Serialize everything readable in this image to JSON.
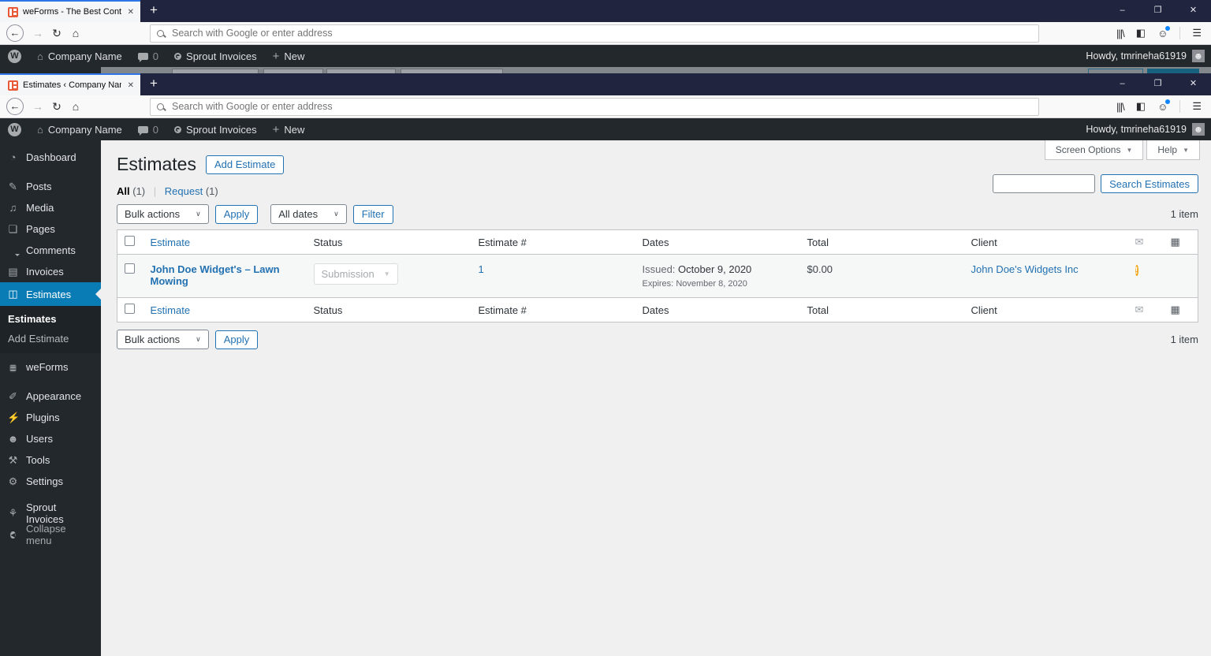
{
  "colors": {
    "accent_blue": "#2271b1",
    "active_menu_blue": "#0a7cb5",
    "warning_orange": "#f0a009",
    "active_tab_line": "#2e75e8"
  },
  "browser": {
    "window1": {
      "tab_title": "weForms - The Best Contact Fo"
    },
    "window2": {
      "tab_title": "Estimates ‹ Company Name —"
    },
    "tab_close": "✕",
    "new_tab": "+",
    "url_placeholder": "Search with Google or enter address",
    "toolbar_icons": {
      "back": "←",
      "forward": "→",
      "refresh": "↻",
      "home": "⌂",
      "library": "|||\\",
      "sidebar_toggle": "◧",
      "account": "☺",
      "menu": "☰"
    },
    "controls": {
      "minimize": "–",
      "restore": "❐",
      "close": "✕"
    }
  },
  "admin_bar": {
    "wp_logo": "W",
    "home_icon": "⌂",
    "site_name": "Company Name",
    "comments_count": "0",
    "sprout_label": "Sprout Invoices",
    "new_icon": "+",
    "new_label": "New",
    "howdy": "Howdy, tmrineha61919",
    "avatar_glyph": "☻"
  },
  "sidebar": {
    "items": [
      {
        "icon": "◔",
        "label": "Dashboard"
      },
      {
        "icon": "✎",
        "label": "Posts"
      },
      {
        "icon": "♫",
        "label": "Media"
      },
      {
        "icon": "❏",
        "label": "Pages"
      },
      {
        "icon": "",
        "label": "Comments"
      },
      {
        "icon": "▤",
        "label": "Invoices"
      },
      {
        "icon": "◫",
        "label": "Estimates"
      },
      {
        "icon": "☰",
        "label": "weForms"
      },
      {
        "icon": "✐",
        "label": "Appearance"
      },
      {
        "icon": "⚡",
        "label": "Plugins"
      },
      {
        "icon": "☻",
        "label": "Users"
      },
      {
        "icon": "⚒",
        "label": "Tools"
      },
      {
        "icon": "⚙",
        "label": "Settings"
      },
      {
        "icon": "⚘",
        "label": "Sprout Invoices"
      },
      {
        "icon": "◀",
        "label": "Collapse menu"
      }
    ],
    "submenu": [
      {
        "label": "Estimates"
      },
      {
        "label": "Add Estimate"
      }
    ]
  },
  "page": {
    "title": "Estimates",
    "add_button": "Add Estimate",
    "screen_options": "Screen Options",
    "help": "Help",
    "caret": "▼",
    "views": {
      "all": "All",
      "all_count": "(1)",
      "sep": "|",
      "request": "Request",
      "request_count": "(1)"
    },
    "controls": {
      "bulk_actions": "Bulk actions",
      "apply": "Apply",
      "all_dates": "All dates",
      "filter": "Filter",
      "chevron": "∨"
    },
    "search_button": "Search Estimates",
    "item_count": "1 item",
    "table": {
      "headers": {
        "title": "Estimate",
        "status": "Status",
        "number": "Estimate #",
        "dates": "Dates",
        "total": "Total",
        "client": "Client"
      },
      "header_icons": {
        "envelope": "✉",
        "notes": "▦"
      },
      "row": {
        "title": "John Doe Widget's – Lawn Mowing",
        "status": "Submission",
        "number": "1",
        "issued_label": "Issued:",
        "issued_date": "October 9, 2020",
        "expires_label": "Expires:",
        "expires_date": "November 8, 2020",
        "total": "$0.00",
        "client": "John Doe's Widgets Inc",
        "warning": "!"
      }
    }
  }
}
